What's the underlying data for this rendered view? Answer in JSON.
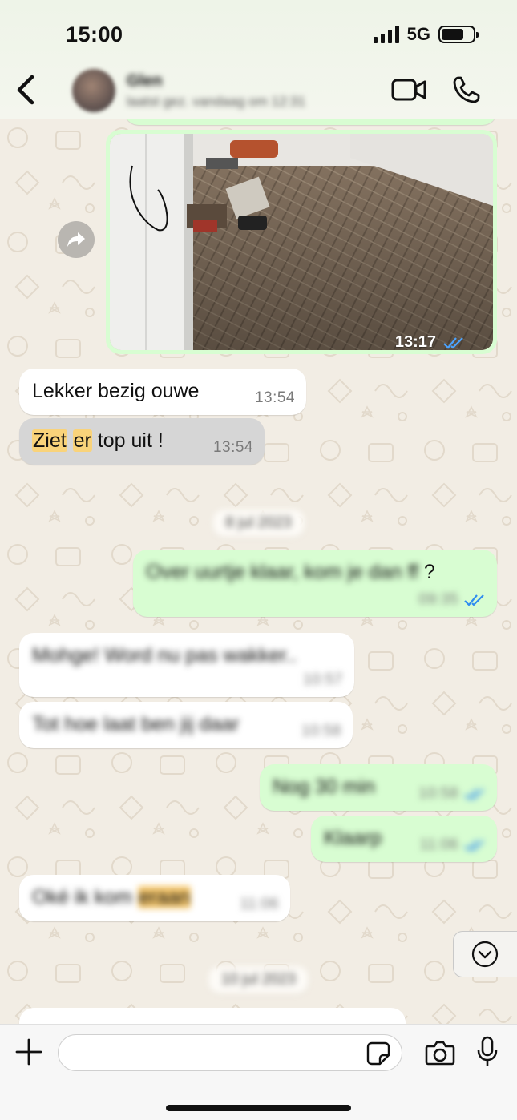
{
  "status_bar": {
    "time": "15:00",
    "network": "5G",
    "battery_level": 0.72
  },
  "header": {
    "contact_name": "Glen",
    "contact_subtitle": "laatst gez. vandaag om 12:31",
    "icons": [
      "chevron-left-icon",
      "video-camera-icon",
      "phone-icon"
    ]
  },
  "messages": {
    "photo": {
      "time": "13:17",
      "status": "read"
    },
    "m1": {
      "text": "Lekker bezig ouwe",
      "time": "13:54"
    },
    "m2": {
      "word1": "Ziet",
      "word2": "er",
      "rest": " top uit !",
      "time": "13:54"
    },
    "date1": "8 jul 2023",
    "m3": {
      "text": "Over uurtje klaar, kom je dan ff",
      "suffix": " ?",
      "time": "09:35",
      "status": "read"
    },
    "m4": {
      "text": "Mohge! Word nu pas wakker..",
      "time": "10:57"
    },
    "m5": {
      "text": "Tot hoe laat ben jij daar",
      "time": "10:58"
    },
    "m6": {
      "text": "Nog 30 min",
      "time": "10:58",
      "status": "read"
    },
    "m7": {
      "text": "Klaarp",
      "time": "11:06",
      "status": "read"
    },
    "m8": {
      "text": "Oké ik kom ",
      "highlight": "eraan",
      "time": "11:06"
    },
    "date2": "10 jul 2023"
  },
  "input": {
    "placeholder": ""
  },
  "colors": {
    "outgoing_bubble": "#d8fdd2",
    "incoming_bubble": "#ffffff",
    "selected_bubble": "#d6d6d6",
    "read_tick": "#2f8cf0",
    "highlight": "#f9d37a",
    "wallpaper": "#f2ede4"
  }
}
